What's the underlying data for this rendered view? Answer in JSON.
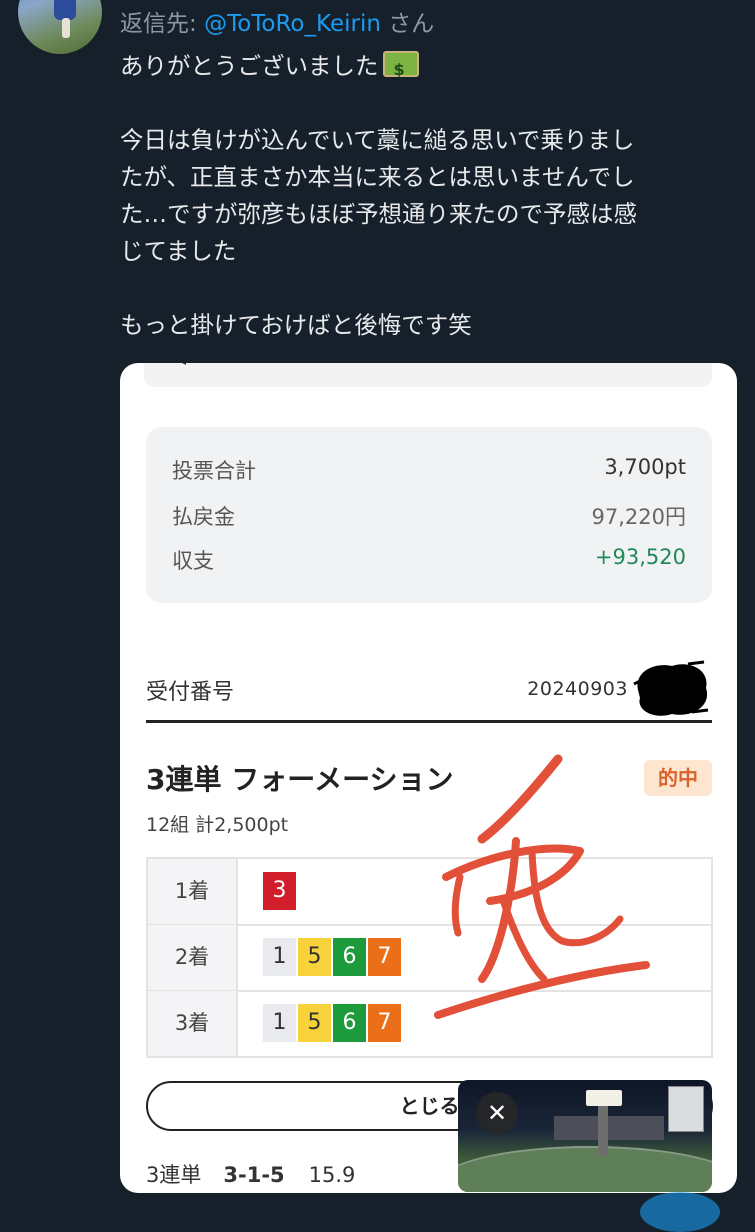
{
  "reply": {
    "prefix": "返信先: ",
    "handle": "@ToToRo_Keirin",
    "suffix": " さん"
  },
  "tweet": {
    "line1": "ありがとうございました",
    "emoji_icon": "money-banknote-icon",
    "line2": "今日は負けが込んでいて藁に縋る思いで乗りまし",
    "line3": "たが、正直まさか本当に来るとは思いませんでし",
    "line4": "た…ですが弥彦もほぼ予想通り来たので予感は感",
    "line5": "じてました",
    "line6": "もっと掛けておけばと後悔です笑"
  },
  "ticket": {
    "summary": {
      "total_label": "投票合計",
      "total_value": "3,700pt",
      "payout_label": "払戻金",
      "payout_value": "97,220円",
      "balance_label": "収支",
      "balance_value": "+93,520"
    },
    "receipt_label": "受付番号",
    "receipt_value": "20240903",
    "bet_type": "3連単 フォーメーション",
    "hit_badge": "的中",
    "bet_detail": "12組 計2,500pt",
    "rows": [
      {
        "place": "1着",
        "numbers": [
          "3"
        ]
      },
      {
        "place": "2着",
        "numbers": [
          "1",
          "5",
          "6",
          "7"
        ]
      },
      {
        "place": "3着",
        "numbers": [
          "1",
          "5",
          "6",
          "7"
        ]
      }
    ],
    "close_button": "とじる",
    "result": {
      "type": "3連単",
      "combo": "3-1-5",
      "odds": "15.9"
    },
    "colors": {
      "1": "#e9eaee",
      "3": "#d21e2b",
      "5": "#f7d23b",
      "6": "#1d9a3c",
      "7": "#ea6f18",
      "balance_green": "#1f8a58",
      "hit_badge_bg": "#fde5cf"
    }
  },
  "video": {
    "close_icon": "close-icon"
  }
}
